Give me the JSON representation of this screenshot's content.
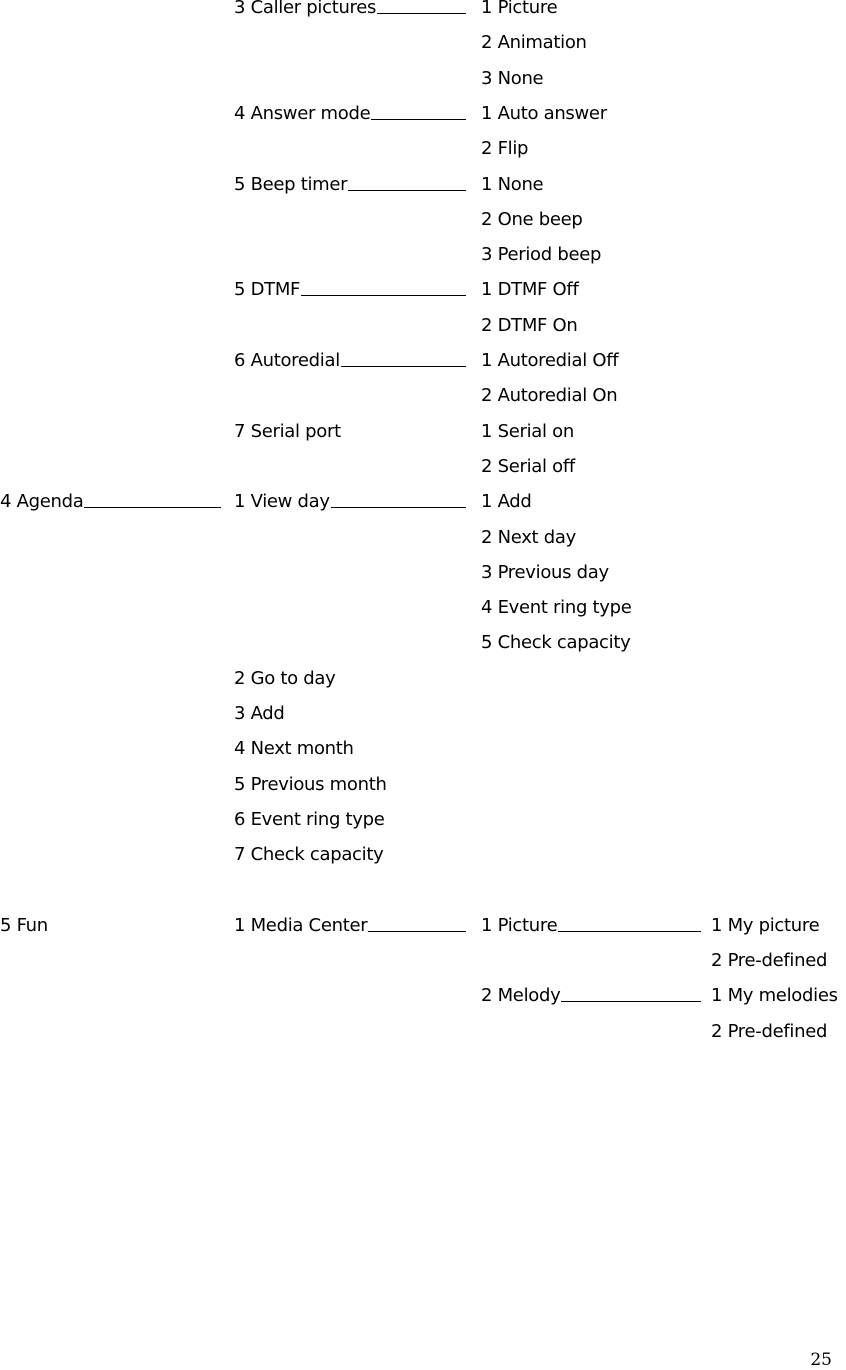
{
  "menu_tree": {
    "rows": [
      {
        "c2": "3 Caller pictures",
        "c3": "1 Picture"
      },
      {
        "c3": "2 Animation"
      },
      {
        "c3": "3 None"
      },
      {
        "c2": "4 Answer mode",
        "c3": "1 Auto answer"
      },
      {
        "c3": "2 Flip"
      },
      {
        "c2": "5 Beep timer",
        "c3": "1 None"
      },
      {
        "c3": "2 One beep"
      },
      {
        "c3": "3 Period beep"
      },
      {
        "c2": "5 DTMF",
        "c3": "1 DTMF Off"
      },
      {
        "c3": "2 DTMF On"
      },
      {
        "c2": "6 Autoredial",
        "c3": "1 Autoredial Off"
      },
      {
        "c3": "2 Autoredial On"
      },
      {
        "c2": "7 Serial port",
        "c3": "1 Serial on",
        "noline": true
      },
      {
        "c3": "2 Serial off"
      },
      {
        "c1": "4 Agenda",
        "c2": "1 View day",
        "c3": "1 Add"
      },
      {
        "c3": "2 Next day"
      },
      {
        "c3": "3 Previous day"
      },
      {
        "c3": "4 Event ring type"
      },
      {
        "c3": "5 Check capacity"
      },
      {
        "c2": "2 Go to day"
      },
      {
        "c2": "3 Add"
      },
      {
        "c2": "4 Next month"
      },
      {
        "c2": "5 Previous month"
      },
      {
        "c2": "6 Event ring type"
      },
      {
        "c2": "7 Check capacity"
      },
      {},
      {
        "c1": "5 Fun",
        "c2": "1 Media Center",
        "c3": "1 Picture",
        "c4": "1 My picture",
        "noline1": true
      },
      {
        "c4": "2 Pre-defined"
      },
      {
        "c3": "2 Melody",
        "c4": "1 My melodies"
      },
      {
        "c4": "2 Pre-defined"
      }
    ]
  },
  "footer": {
    "page_number": "25"
  }
}
